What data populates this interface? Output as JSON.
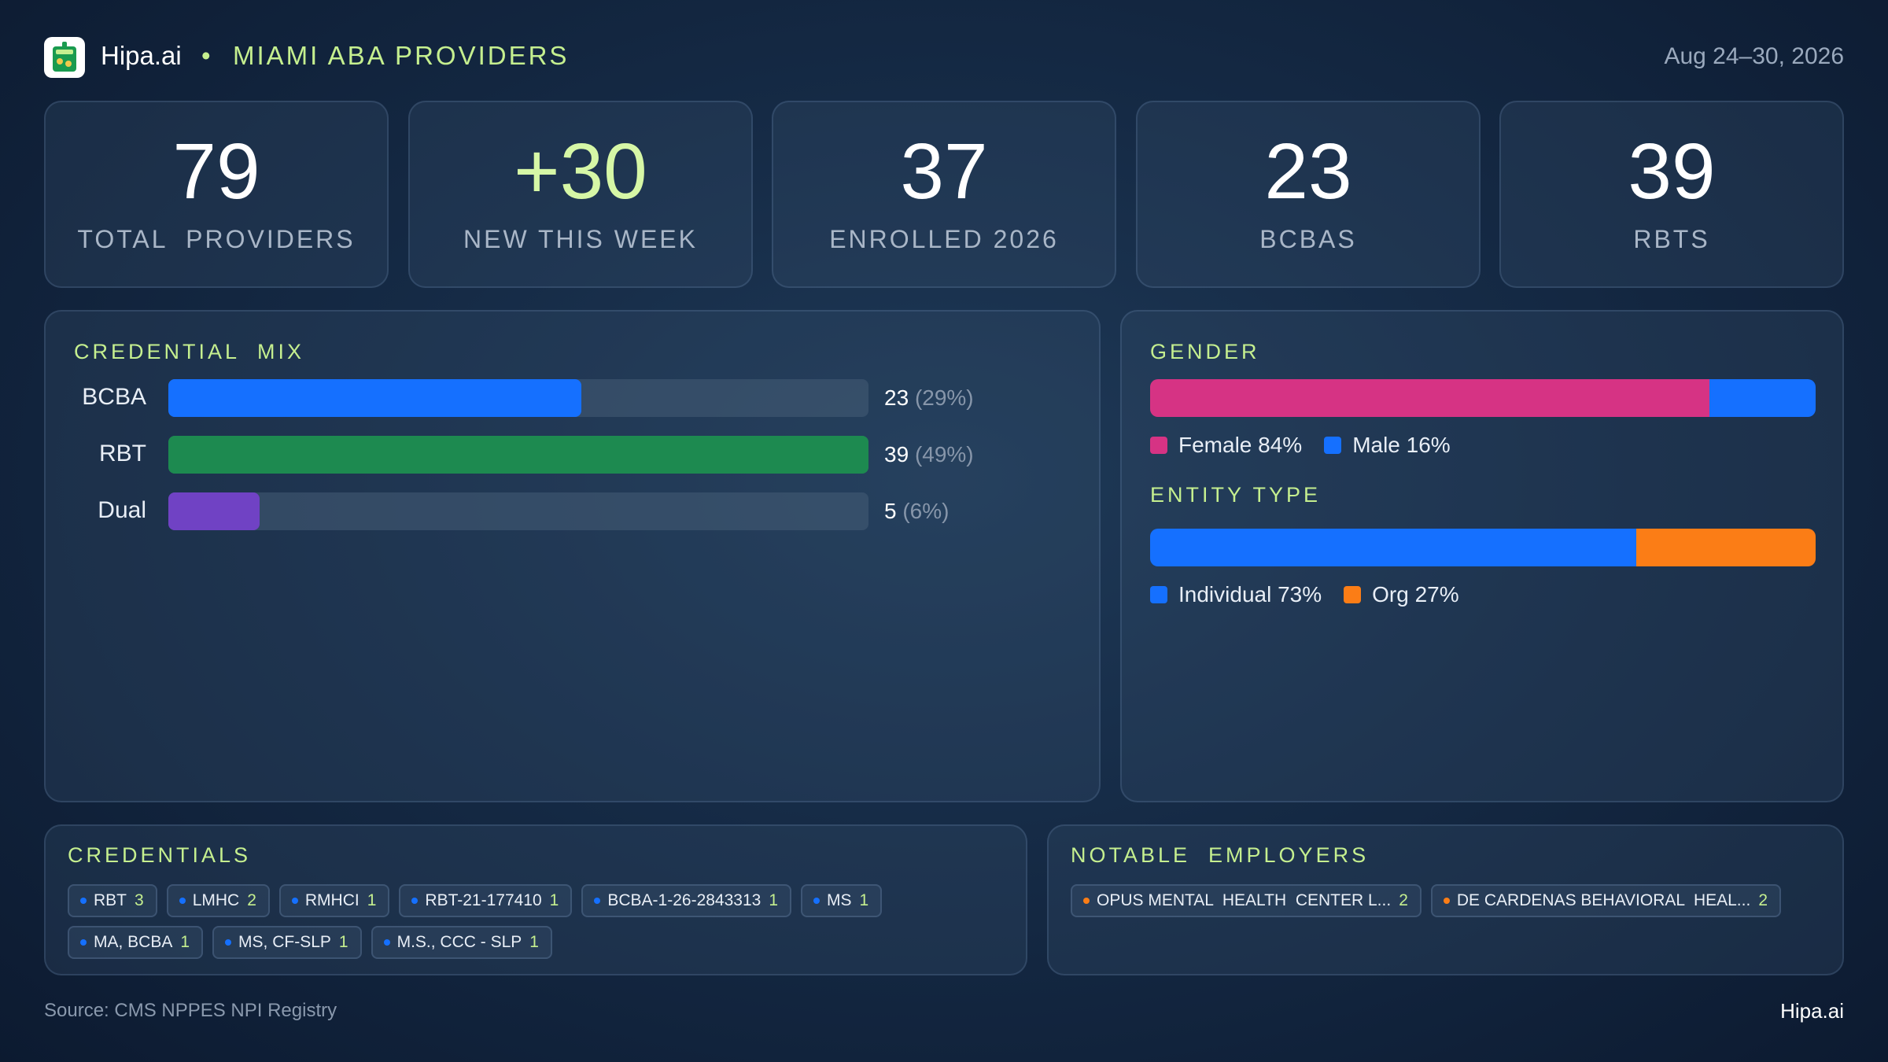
{
  "header": {
    "brand": "Hipa.ai",
    "separator": "•",
    "title": "MIAMI ABA PROVIDERS",
    "date_range": "Aug 24–30, 2026"
  },
  "stats": [
    {
      "value": "79",
      "label": "TOTAL  PROVIDERS"
    },
    {
      "value": "+30",
      "label": "NEW THIS WEEK"
    },
    {
      "value": "37",
      "label": "ENROLLED 2026"
    },
    {
      "value": "23",
      "label": "BCBAS"
    },
    {
      "value": "39",
      "label": "RBTS"
    }
  ],
  "credential_mix": {
    "title": "CREDENTIAL  MIX",
    "rows": [
      {
        "label": "BCBA",
        "value": "23",
        "pct": "(29%)",
        "fill": 0.59,
        "color": "#1570ff"
      },
      {
        "label": "RBT",
        "value": "39",
        "pct": "(49%)",
        "fill": 1.0,
        "color": "#1d8a50"
      },
      {
        "label": "Dual",
        "value": "5",
        "pct": "(6%)",
        "fill": 0.13,
        "color": "#7042c4"
      }
    ]
  },
  "gender": {
    "title": "GENDER",
    "segments": [
      {
        "label": "Female 84%",
        "share": 0.84,
        "color": "#d63384"
      },
      {
        "label": "Male 16%",
        "share": 0.16,
        "color": "#1570ff"
      }
    ]
  },
  "entity_type": {
    "title": "ENTITY TYPE",
    "segments": [
      {
        "label": "Individual 73%",
        "share": 0.73,
        "color": "#1570ff"
      },
      {
        "label": "Org 27%",
        "share": 0.27,
        "color": "#fb7d16"
      }
    ]
  },
  "credentials": {
    "title": "CREDENTIALS",
    "chips": [
      {
        "label": "RBT",
        "count": "3"
      },
      {
        "label": "LMHC",
        "count": "2"
      },
      {
        "label": "RMHCI",
        "count": "1"
      },
      {
        "label": "RBT-21-177410",
        "count": "1"
      },
      {
        "label": "BCBA-1-26-2843313",
        "count": "1"
      },
      {
        "label": "MS",
        "count": "1"
      },
      {
        "label": "MA, BCBA",
        "count": "1"
      },
      {
        "label": "MS, CF-SLP",
        "count": "1"
      },
      {
        "label": "M.S., CCC - SLP",
        "count": "1"
      }
    ],
    "dot_color": "#1570ff"
  },
  "employers": {
    "title": "NOTABLE  EMPLOYERS",
    "chips": [
      {
        "label": "OPUS MENTAL  HEALTH  CENTER L...",
        "count": "2"
      },
      {
        "label": "DE CARDENAS BEHAVIORAL  HEAL...",
        "count": "2"
      }
    ],
    "dot_color": "#fb7d16"
  },
  "footer": {
    "source": "Source: CMS NPPES NPI Registry",
    "brand": "Hipa.ai"
  },
  "icons": {
    "logo": "cup-drink-icon"
  }
}
